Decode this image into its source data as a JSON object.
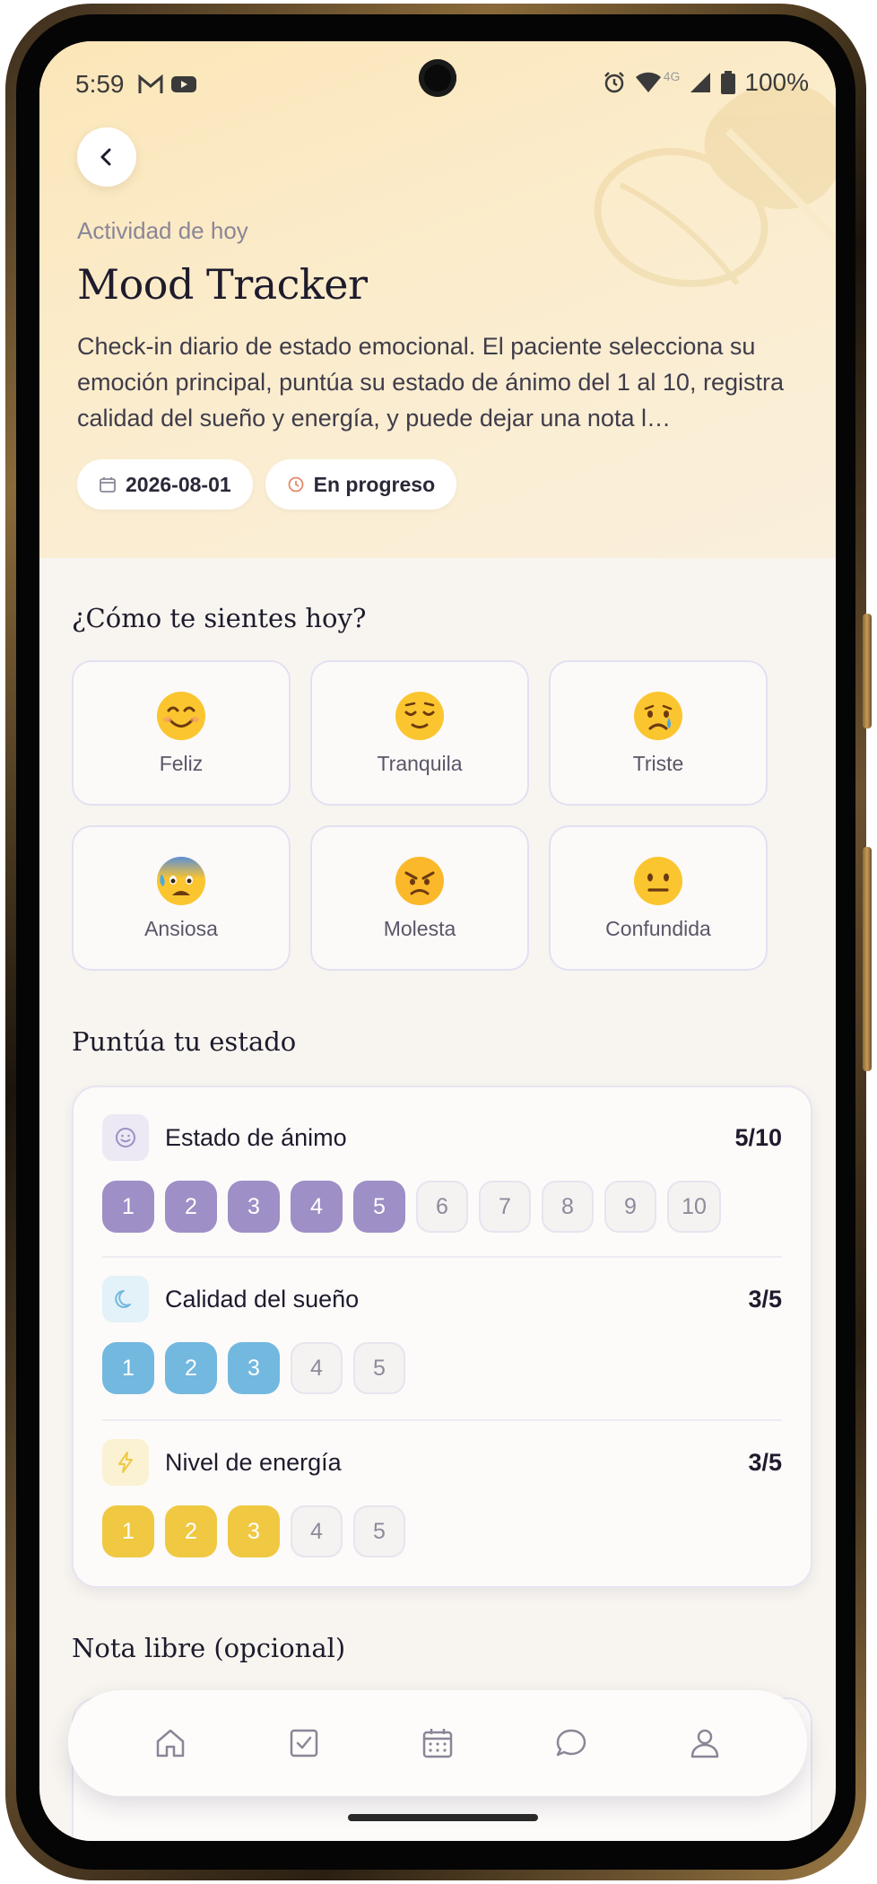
{
  "status_bar": {
    "time": "5:59",
    "battery": "100%",
    "network": "4G"
  },
  "header": {
    "eyebrow": "Actividad de hoy",
    "title": "Mood Tracker",
    "description": "Check-in diario de estado emocional. El paciente selecciona su emoción principal, puntúa su estado de ánimo del 1 al 10, registra calidad del sueño y energía, y puede dejar una nota l…",
    "date_chip": "2026-08-01",
    "status_chip": "En progreso"
  },
  "emotions": {
    "title": "¿Cómo te sientes hoy?",
    "items": [
      {
        "label": "Feliz",
        "icon": "smiling-face-icon"
      },
      {
        "label": "Tranquila",
        "icon": "relieved-face-icon"
      },
      {
        "label": "Triste",
        "icon": "crying-face-icon"
      },
      {
        "label": "Ansiosa",
        "icon": "anxious-face-icon"
      },
      {
        "label": "Molesta",
        "icon": "angry-face-icon"
      },
      {
        "label": "Confundida",
        "icon": "neutral-face-icon"
      }
    ]
  },
  "rating": {
    "title": "Puntúa tu estado",
    "metrics": [
      {
        "name": "Estado de ánimo",
        "value_text": "5/10",
        "value": 5,
        "max": 10,
        "color": "#9e8fc6",
        "icon": "smile-icon",
        "pills": [
          "1",
          "2",
          "3",
          "4",
          "5",
          "6",
          "7",
          "8",
          "9",
          "10"
        ]
      },
      {
        "name": "Calidad del sueño",
        "value_text": "3/5",
        "value": 3,
        "max": 5,
        "color": "#73b8df",
        "icon": "moon-icon",
        "pills": [
          "1",
          "2",
          "3",
          "4",
          "5"
        ]
      },
      {
        "name": "Nivel de energía",
        "value_text": "3/5",
        "value": 3,
        "max": 5,
        "color": "#f0c842",
        "icon": "lightning-icon",
        "pills": [
          "1",
          "2",
          "3",
          "4",
          "5"
        ]
      }
    ]
  },
  "note": {
    "title": "Nota libre (opcional)"
  },
  "nav": {
    "items": [
      "home-icon",
      "tasks-icon",
      "calendar-icon",
      "chat-icon",
      "profile-icon"
    ]
  }
}
